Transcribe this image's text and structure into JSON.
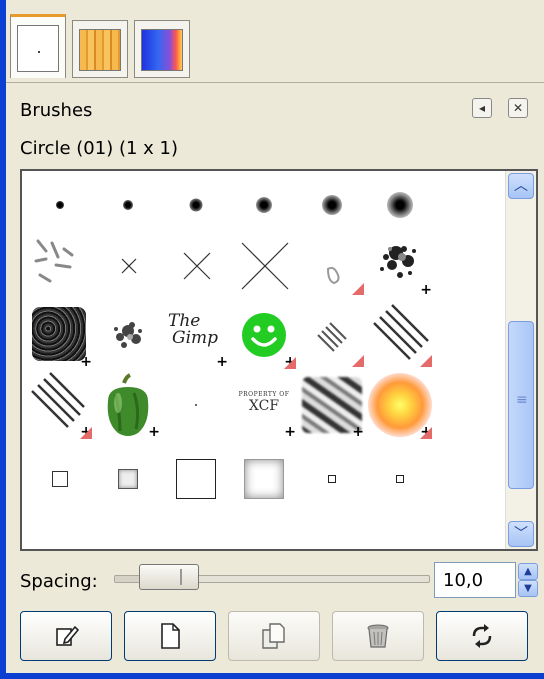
{
  "tabs": [
    {
      "name": "brushes-tab",
      "icon": "brush-preview-icon",
      "active": true
    },
    {
      "name": "patterns-tab",
      "icon": "pattern-preview-icon",
      "active": false
    },
    {
      "name": "gradients-tab",
      "icon": "gradient-preview-icon",
      "active": false
    }
  ],
  "panel": {
    "title": "Brushes",
    "menu_button_icon": "tab-menu-icon",
    "close_button_icon": "close-icon",
    "selected_brush": "Circle (01) (1 x 1)"
  },
  "brush_grid": {
    "rows": 5,
    "columns": 6,
    "items": [
      "circle-brush",
      "circle-brush",
      "circle-brush",
      "circle-brush",
      "circle-brush",
      "circle-brush",
      "pencil-scratch-brush",
      "cross-brush",
      "cross-brush",
      "cross-brush",
      "pepper-stem-brush",
      "splatter-brush",
      "texture-brush",
      "splatter-brush",
      "the-gimp-text-brush",
      "smiley-brush",
      "diagonal-lines-brush",
      "diagonal-lines-brush",
      "diagonal-lines-brush",
      "pepper-brush",
      "dot-brush",
      "property-of-xcf-brush",
      "zebra-brush",
      "sparkle-brush",
      "square-brush",
      "fuzzy-square-brush",
      "large-square-brush",
      "soft-square-brush",
      "small-square-brush",
      "small-square-brush"
    ],
    "gimp_text": [
      "The",
      "Gimp"
    ],
    "xcf_text": [
      "PROPERTY OF",
      "XCF"
    ],
    "scrollbar": {
      "up_icon": "chevron-up-icon",
      "down_icon": "chevron-down-icon"
    }
  },
  "spacing": {
    "label": "Spacing:",
    "value": "10,0",
    "slider_fraction": 0.1,
    "up_icon": "spin-up-icon",
    "down_icon": "spin-down-icon"
  },
  "actions": [
    {
      "name": "edit-brush-button",
      "icon": "edit-icon",
      "enabled": true
    },
    {
      "name": "new-brush-button",
      "icon": "new-document-icon",
      "enabled": true
    },
    {
      "name": "duplicate-brush-button",
      "icon": "duplicate-icon",
      "enabled": false
    },
    {
      "name": "delete-brush-button",
      "icon": "trash-icon",
      "enabled": false
    },
    {
      "name": "refresh-brushes-button",
      "icon": "refresh-icon",
      "enabled": true
    }
  ],
  "colors": {
    "frame": "#0a3fd1",
    "tab_accent": "#e89a2c",
    "dynamic_marker": "#e56a6a",
    "smiley": "#22cc22"
  }
}
